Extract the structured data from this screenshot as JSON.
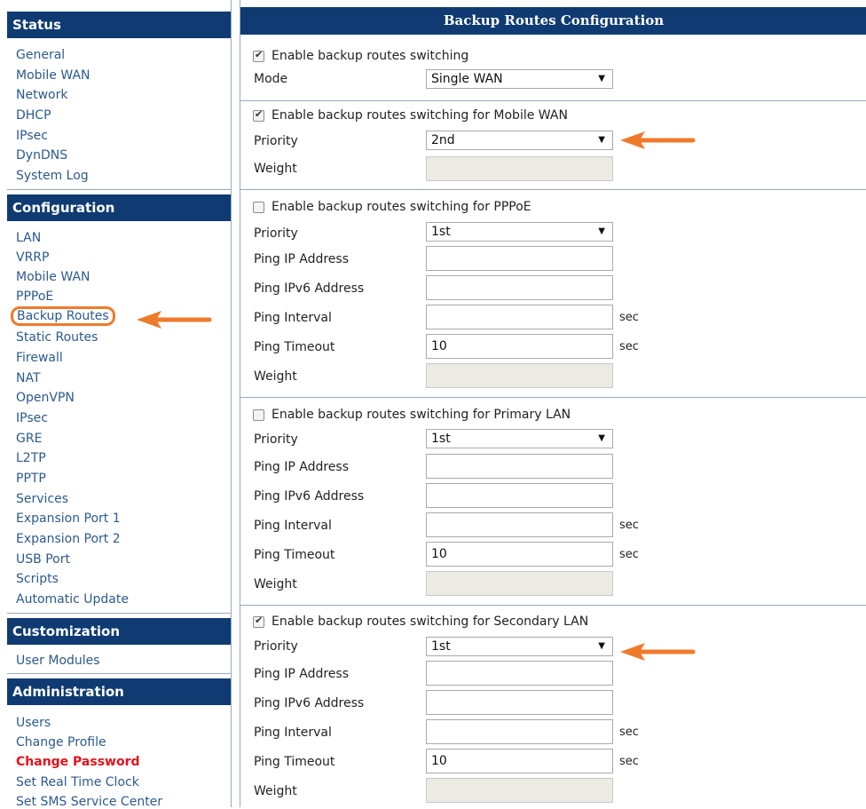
{
  "sidebar": {
    "status": {
      "header": "Status",
      "items": [
        "General",
        "Mobile WAN",
        "Network",
        "DHCP",
        "IPsec",
        "DynDNS",
        "System Log"
      ]
    },
    "configuration": {
      "header": "Configuration",
      "items": [
        "LAN",
        "VRRP",
        "Mobile WAN",
        "PPPoE",
        "Backup Routes",
        "Static Routes",
        "Firewall",
        "NAT",
        "OpenVPN",
        "IPsec",
        "GRE",
        "L2TP",
        "PPTP",
        "Services",
        "Expansion Port 1",
        "Expansion Port 2",
        "USB Port",
        "Scripts",
        "Automatic Update"
      ]
    },
    "customization": {
      "header": "Customization",
      "items": [
        "User Modules"
      ]
    },
    "administration": {
      "header": "Administration",
      "items": [
        "Users",
        "Change Profile",
        "Change Password",
        "Set Real Time Clock",
        "Set SMS Service Center"
      ]
    }
  },
  "main": {
    "title": "Backup Routes Configuration",
    "general": {
      "enable_label": "Enable backup routes switching",
      "enable_checked": true,
      "mode_label": "Mode",
      "mode_value": "Single WAN"
    },
    "mobile_wan": {
      "enable_label": "Enable backup routes switching for Mobile WAN",
      "enable_checked": true,
      "priority_label": "Priority",
      "priority_value": "2nd",
      "weight_label": "Weight"
    },
    "pppoe": {
      "enable_label": "Enable backup routes switching for PPPoE",
      "enable_checked": false,
      "priority_label": "Priority",
      "priority_value": "1st",
      "ping_ip_label": "Ping IP Address",
      "ping_ipv6_label": "Ping IPv6 Address",
      "ping_interval_label": "Ping Interval",
      "ping_interval_unit": "sec",
      "ping_timeout_label": "Ping Timeout",
      "ping_timeout_value": "10",
      "ping_timeout_unit": "sec",
      "weight_label": "Weight"
    },
    "primary_lan": {
      "enable_label": "Enable backup routes switching for Primary LAN",
      "enable_checked": false,
      "priority_label": "Priority",
      "priority_value": "1st",
      "ping_ip_label": "Ping IP Address",
      "ping_ipv6_label": "Ping IPv6 Address",
      "ping_interval_label": "Ping Interval",
      "ping_interval_unit": "sec",
      "ping_timeout_label": "Ping Timeout",
      "ping_timeout_value": "10",
      "ping_timeout_unit": "sec",
      "weight_label": "Weight"
    },
    "secondary_lan": {
      "enable_label": "Enable backup routes switching for Secondary LAN",
      "enable_checked": true,
      "priority_label": "Priority",
      "priority_value": "1st",
      "ping_ip_label": "Ping IP Address",
      "ping_ipv6_label": "Ping IPv6 Address",
      "ping_interval_label": "Ping Interval",
      "ping_interval_unit": "sec",
      "ping_timeout_label": "Ping Timeout",
      "ping_timeout_value": "10",
      "ping_timeout_unit": "sec",
      "weight_label": "Weight"
    }
  },
  "colors": {
    "header_bg": "#0f3b72",
    "link": "#2b5a8f",
    "highlight_link": "#e4121b",
    "annotation_orange": "#f07a2c"
  }
}
